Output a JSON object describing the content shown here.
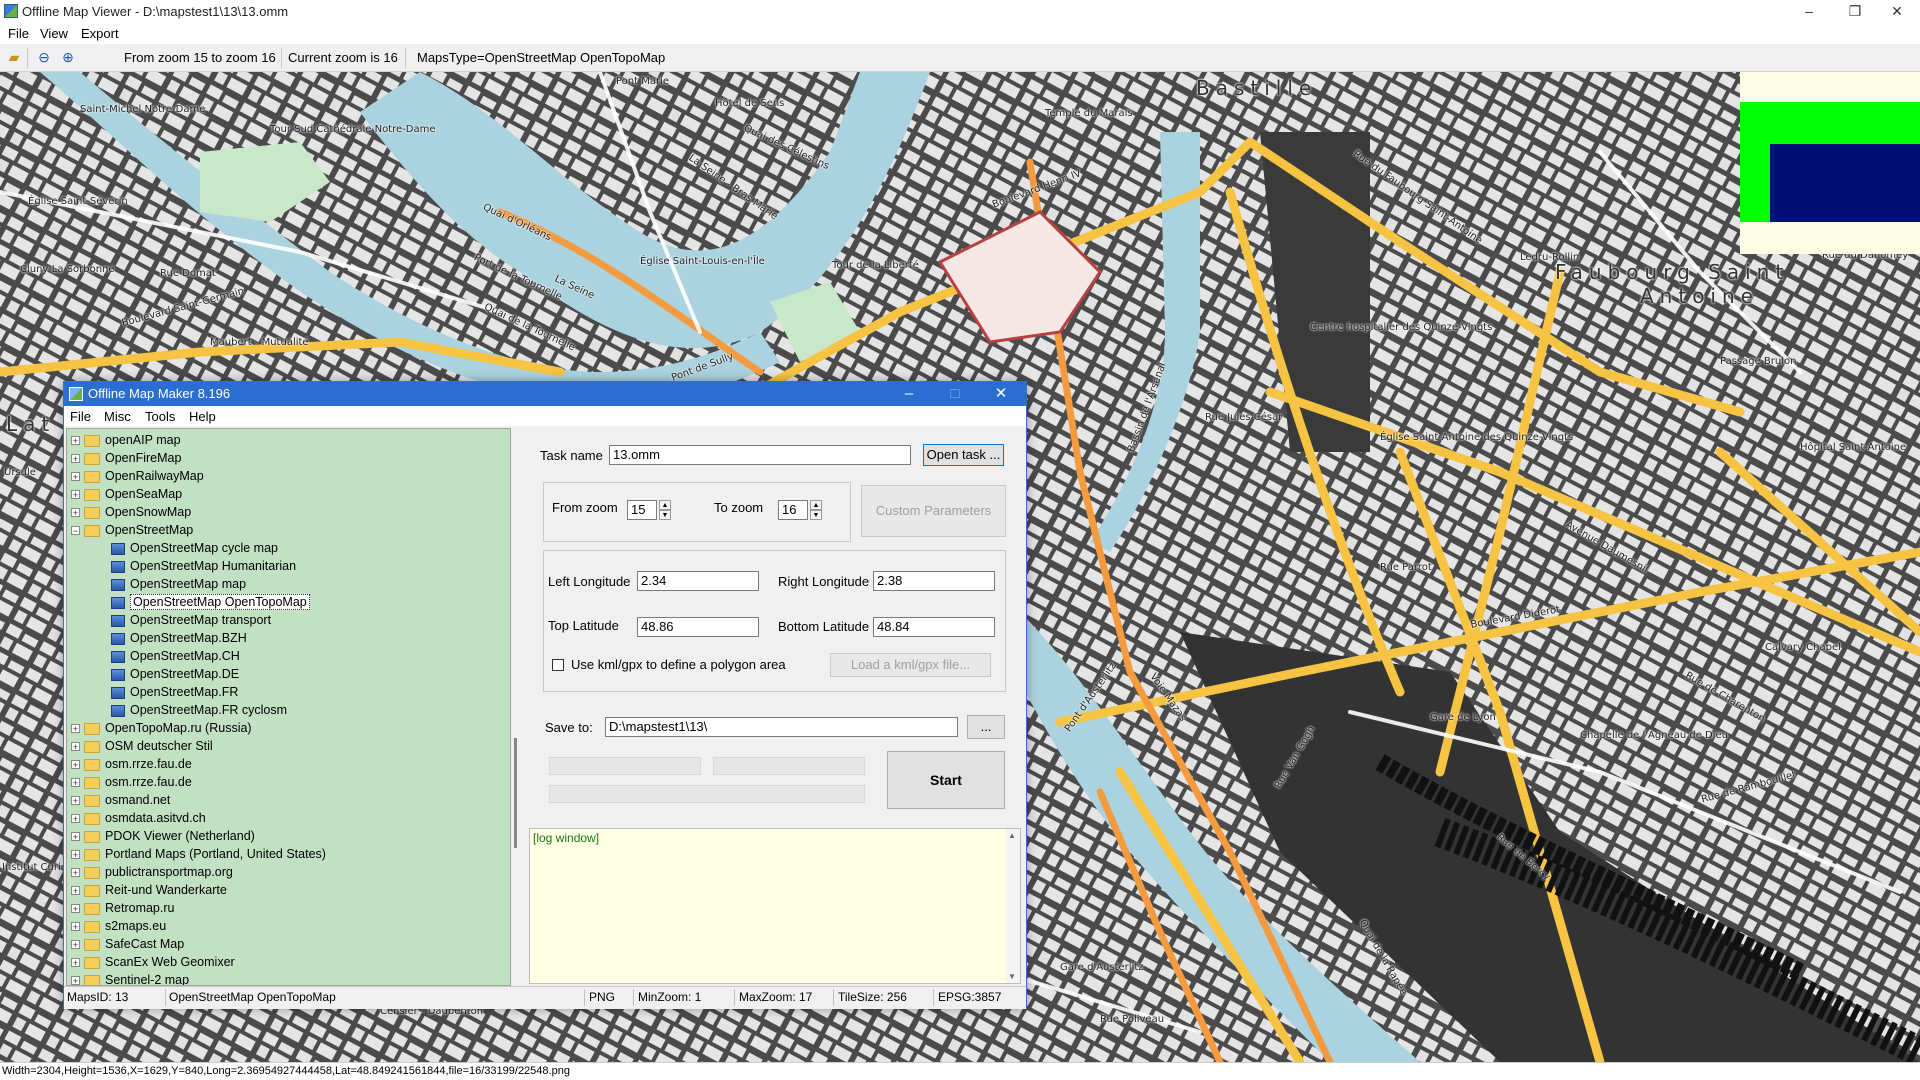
{
  "viewer": {
    "title": "Offline Map Viewer - D:\\mapstest1\\13\\13.omm",
    "menu": [
      "File",
      "View",
      "Export"
    ],
    "toolbar": {
      "zoom_range": "From zoom 15 to zoom 16",
      "current_zoom": "Current zoom is 16",
      "maps_type": "MapsType=OpenStreetMap OpenTopoMap"
    },
    "status": "Width=2304,Height=1536,X=1629,Y=840,Long=2.36954927444458,Lat=48.849241561844,file=16/33199/22548.png"
  },
  "map_labels": {
    "bastille": "Bastille",
    "faubourg": "Faubourg Saint",
    "antoine": "Antoine",
    "notre_dame": "Saint-Michel Notre-Dame",
    "cathedrale": "Tour Sud Cathédrale Notre-Dame",
    "hotel_sens": "Hôtel de Sens",
    "temple": "Temple du Marais",
    "seine": "La Seine",
    "seine2": "La Seine - Bras Marie",
    "eglise_severin": "Église Saint-Séverin",
    "sorbonne": "Cluny-La Sorbonne",
    "bd_st_germain": "Boulevard Saint-Germain",
    "maubert": "Maubert - Mutualité",
    "st_louis": "Église Saint-Louis-en-l'Île",
    "tournelle": "Port de la Tournelle",
    "tour_liberte": "Tour de la Liberté",
    "bd_henri": "Boulevard Henri IV",
    "rue_lyon": "Rue de Lyon",
    "quinze_vingts": "Centre hospitalier des Quinze-Vingts",
    "rue_fbg": "Rue du Faubourg Saint-Antoine",
    "ledru": "Ledru-Rollin",
    "daumesnil": "Avenue Daumesnil",
    "diderot": "Boulevard Diderot",
    "gare_lyon": "Gare de Lyon",
    "parrot": "Rue Parrot",
    "rapee": "Quai de la Rapée",
    "austerlitz": "Gare d'Austerlitz",
    "pont_austerlitz": "Pont d'Austerlitz",
    "mazas": "Voie Mazas",
    "bercy": "Rue de Bercy",
    "van_gogh": "Rue Van Gogh",
    "calvaire": "Calvary Chapel",
    "rambouillet": "Rue de Rambouillet",
    "charenton": "Rue de Charenton",
    "brulon": "Passage Brulon",
    "jules_cesar": "Rue Jules César",
    "dahomey": "Rue du Dahomey",
    "st_antoine_hop": "Hôpital Saint-Antoine",
    "arsenal": "Bassin de l'Arsenal",
    "sully": "Pont de Sully",
    "latin": "Lat",
    "poliveau": "Rue Poliveau",
    "censier": "Censier - Daubenton",
    "institut": "Institut Curie",
    "pont_marie": "Pont Marie",
    "rue_dormat": "Rue Domat",
    "quai_tournelle": "Quai de la Tournelle",
    "quai_orleans": "Quai d'Orléans",
    "quai_celestins": "Quai des Célestins",
    "ursule": "Ursule",
    "agneau": "Chapelle de l'Agneau de Dieu",
    "eglise_st_antoine": "Église Saint-Antoine des Quinze-Vingts"
  },
  "dialog": {
    "title": "Offline Map Maker 8.196",
    "menu": [
      "File",
      "Misc",
      "Tools",
      "Help"
    ],
    "tree": [
      {
        "label": "openAIP map",
        "type": "folder",
        "expanded": false
      },
      {
        "label": "OpenFireMap",
        "type": "folder",
        "expanded": false
      },
      {
        "label": "OpenRailwayMap",
        "type": "folder",
        "expanded": false
      },
      {
        "label": "OpenSeaMap",
        "type": "folder",
        "expanded": false
      },
      {
        "label": "OpenSnowMap",
        "type": "folder",
        "expanded": false
      },
      {
        "label": "OpenStreetMap",
        "type": "folder",
        "expanded": true
      },
      {
        "label": "OpenStreetMap cycle map",
        "type": "map"
      },
      {
        "label": "OpenStreetMap Humanitarian",
        "type": "map"
      },
      {
        "label": "OpenStreetMap map",
        "type": "map"
      },
      {
        "label": "OpenStreetMap OpenTopoMap",
        "type": "map",
        "selected": true
      },
      {
        "label": "OpenStreetMap transport",
        "type": "map"
      },
      {
        "label": "OpenStreetMap.BZH",
        "type": "map"
      },
      {
        "label": "OpenStreetMap.CH",
        "type": "map"
      },
      {
        "label": "OpenStreetMap.DE",
        "type": "map"
      },
      {
        "label": "OpenStreetMap.FR",
        "type": "map"
      },
      {
        "label": "OpenStreetMap.FR cyclosm",
        "type": "map"
      },
      {
        "label": "OpenTopoMap.ru (Russia)",
        "type": "folder",
        "expanded": false
      },
      {
        "label": "OSM deutscher Stil",
        "type": "folder",
        "expanded": false
      },
      {
        "label": "osm.rrze.fau.de",
        "type": "folder",
        "expanded": false
      },
      {
        "label": "osm.rrze.fau.de",
        "type": "folder",
        "expanded": false
      },
      {
        "label": "osmand.net",
        "type": "folder",
        "expanded": false
      },
      {
        "label": "osmdata.asitvd.ch",
        "type": "folder",
        "expanded": false
      },
      {
        "label": "PDOK Viewer (Netherland)",
        "type": "folder",
        "expanded": false
      },
      {
        "label": "Portland Maps (Portland, United States)",
        "type": "folder",
        "expanded": false
      },
      {
        "label": "publictransportmap.org",
        "type": "folder",
        "expanded": false
      },
      {
        "label": "Reit-und Wanderkarte",
        "type": "folder",
        "expanded": false
      },
      {
        "label": "Retromap.ru",
        "type": "folder",
        "expanded": false
      },
      {
        "label": "s2maps.eu",
        "type": "folder",
        "expanded": false
      },
      {
        "label": "SafeCast Map",
        "type": "folder",
        "expanded": false
      },
      {
        "label": "ScanEx Web Geomixer",
        "type": "folder",
        "expanded": false
      },
      {
        "label": "Sentinel-2 map",
        "type": "folder",
        "expanded": false
      }
    ],
    "task_name_label": "Task name",
    "task_name_value": "13.omm",
    "open_task": "Open task ...",
    "from_zoom_label": "From zoom",
    "from_zoom_value": "15",
    "to_zoom_label": "To zoom",
    "to_zoom_value": "16",
    "custom_params": "Custom Parameters",
    "left_lon_label": "Left Longitude",
    "left_lon_value": "2.34",
    "right_lon_label": "Right Longitude",
    "right_lon_value": "2.38",
    "top_lat_label": "Top Latitude",
    "top_lat_value": "48.86",
    "bottom_lat_label": "Bottom Latitude",
    "bottom_lat_value": "48.84",
    "kml_label": "Use kml/gpx to define a polygon area",
    "kml_button": "Load a kml/gpx file...",
    "save_to_label": "Save to:",
    "save_to_value": "D:\\mapstest1\\13\\",
    "browse": "...",
    "start": "Start",
    "log": "[log window]",
    "status": {
      "maps_id": "MapsID: 13",
      "maps_name": "OpenStreetMap OpenTopoMap",
      "format": "PNG",
      "min_zoom": "MinZoom: 1",
      "max_zoom": "MaxZoom: 17",
      "tile_size": "TileSize: 256",
      "epsg": "EPSG:3857"
    }
  }
}
